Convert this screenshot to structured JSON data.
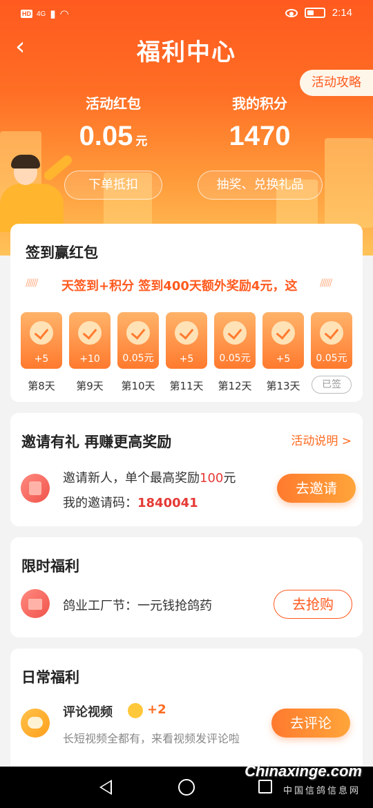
{
  "status_bar": {
    "time": "2:14",
    "network": "4G"
  },
  "header": {
    "title": "福利中心",
    "guide_label": "活动攻略",
    "red_packet": {
      "label": "活动红包",
      "value": "0.05",
      "unit": "元",
      "action": "下单抵扣"
    },
    "points": {
      "label": "我的积分",
      "value": "1470",
      "action": "抽奖、兑换礼品"
    }
  },
  "checkin": {
    "title": "签到赢红包",
    "ticker": "天签到+积分 签到400天额外奖励4元，这",
    "days": [
      {
        "label": "第8天",
        "reward": "+5"
      },
      {
        "label": "第9天",
        "reward": "+10"
      },
      {
        "label": "第10天",
        "reward": "0.05元"
      },
      {
        "label": "第11天",
        "reward": "+5"
      },
      {
        "label": "第12天",
        "reward": "0.05元"
      },
      {
        "label": "第13天",
        "reward": "+5"
      },
      {
        "label": "已签",
        "reward": "0.05元"
      }
    ]
  },
  "invite": {
    "title": "邀请有礼  再赚更高奖励",
    "rules_link": "活动说明 >",
    "desc_prefix": "邀请新人，单个最高奖励",
    "desc_amount": "100",
    "desc_suffix": "元",
    "code_label": "我的邀请码：",
    "code": "1840041",
    "button": "去邀请"
  },
  "limited": {
    "title": "限时福利",
    "item_text": "鸽业工厂节：一元钱抢鸽药",
    "button": "去抢购"
  },
  "daily": {
    "title": "日常福利",
    "item_title": "评论视频",
    "item_points": "+2",
    "item_desc": "长短视频全都有，来看视频发评论啦",
    "button": "去评论"
  },
  "watermark": {
    "main": "Chinaxinge.com",
    "sub": "中国信鸽信息网"
  },
  "colors": {
    "accent": "#ff5a1f",
    "highlight": "#e53935"
  }
}
